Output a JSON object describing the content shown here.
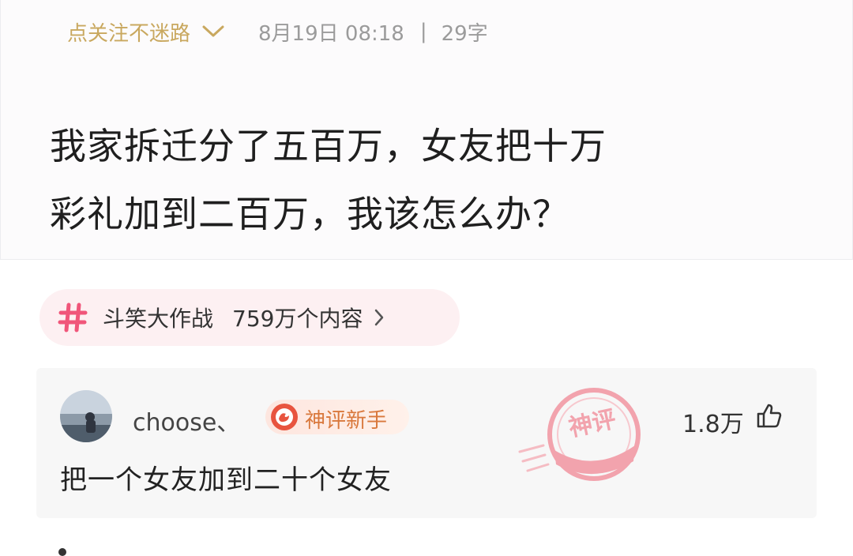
{
  "post": {
    "follow_label": "点关注不迷路",
    "date": "8月19日 08:18",
    "separator": "|",
    "word_count": "29字",
    "title_lines": [
      "我家拆迁分了五百万，女友把十万",
      "彩礼加到二百万，我该怎么办？"
    ]
  },
  "topic": {
    "icon": "hash-icon",
    "name": "斗笑大作战",
    "count": "759万个内容",
    "arrow_icon": "chevron-right-icon",
    "accent_color": "#f0567a"
  },
  "comment": {
    "username": "choose、",
    "badge_label": "神评新手",
    "stamp_text": "神评",
    "likes": "1.8万",
    "like_icon": "thumbs-up-icon",
    "text": "把一个女友加到二十个女友",
    "badge_color": "#d9783c",
    "stamp_color": "#f2a3ad"
  }
}
